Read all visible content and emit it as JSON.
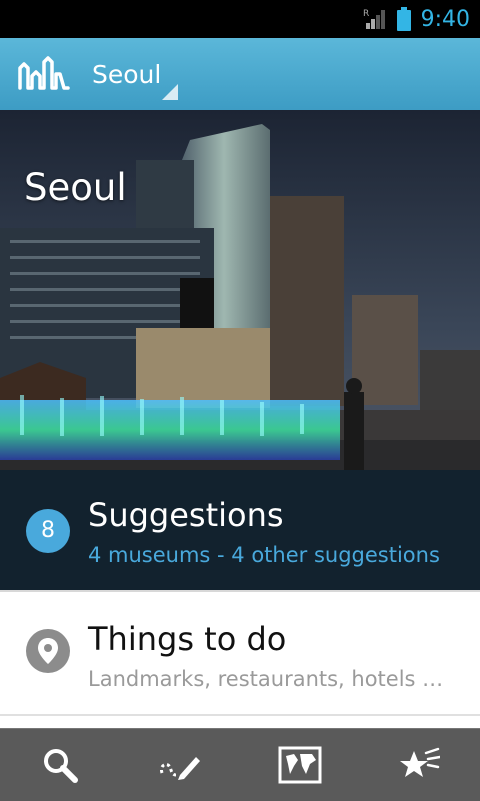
{
  "status_bar": {
    "time": "9:40",
    "icons": [
      "signal-roaming-icon",
      "battery-icon"
    ]
  },
  "action_bar": {
    "logo_icon": "city-skyline-logo-icon",
    "city": "Seoul"
  },
  "hero": {
    "title": "Seoul"
  },
  "suggestions": {
    "count": "8",
    "title": "Suggestions",
    "subtitle": "4 museums - 4 other suggestions",
    "color": "#49a9dc"
  },
  "things_to_do": {
    "icon": "map-pin-icon",
    "title": "Things to do",
    "subtitle": "Landmarks, restaurants, hotels …"
  },
  "bottom_nav": {
    "tabs": [
      {
        "icon": "search-icon"
      },
      {
        "icon": "itinerary-pen-icon"
      },
      {
        "icon": "world-map-icon"
      },
      {
        "icon": "favorites-stars-icon"
      }
    ]
  }
}
